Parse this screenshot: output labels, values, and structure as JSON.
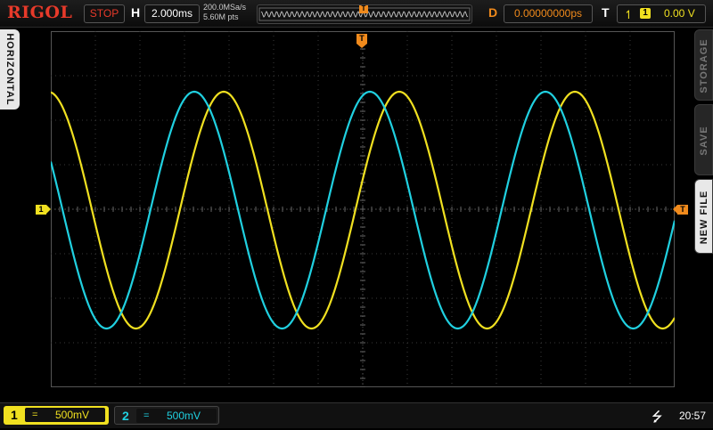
{
  "brand": "RIGOL",
  "topbar": {
    "run_state": "STOP",
    "horizontal_label": "H",
    "timebase": "2.000ms",
    "sample_rate": "200.0MSa/s",
    "memory_depth": "5.60M pts",
    "mem_trigger_marker": "T",
    "delay_label": "D",
    "delay_value": "0.00000000ps",
    "trigger_label": "T",
    "trigger_edge": "rising-edge-icon",
    "trigger_source": "1",
    "trigger_level": "0.00 V"
  },
  "left_menu": {
    "tab_label": "HORIZONTAL"
  },
  "right_menu": {
    "tabs": [
      {
        "label": "STORAGE",
        "active": false
      },
      {
        "label": "SAVE",
        "active": false
      },
      {
        "label": "NEW FILE",
        "active": true
      }
    ]
  },
  "markers": {
    "ch1_offset": "1",
    "trigger_pos": "T",
    "trigger_level": "T"
  },
  "channels": [
    {
      "number": "1",
      "coupling": "=",
      "scale": "500mV",
      "color": "#f0e020",
      "active": true
    },
    {
      "number": "2",
      "coupling": "=",
      "scale": "500mV",
      "color": "#20d0e0",
      "active": false
    }
  ],
  "status": {
    "usb_icon": "usb-icon",
    "time": "20:57"
  },
  "colors": {
    "ch1": "#f0e020",
    "ch2": "#20d0e0",
    "trigger": "#f08a1c",
    "brand": "#e83a2a"
  }
}
